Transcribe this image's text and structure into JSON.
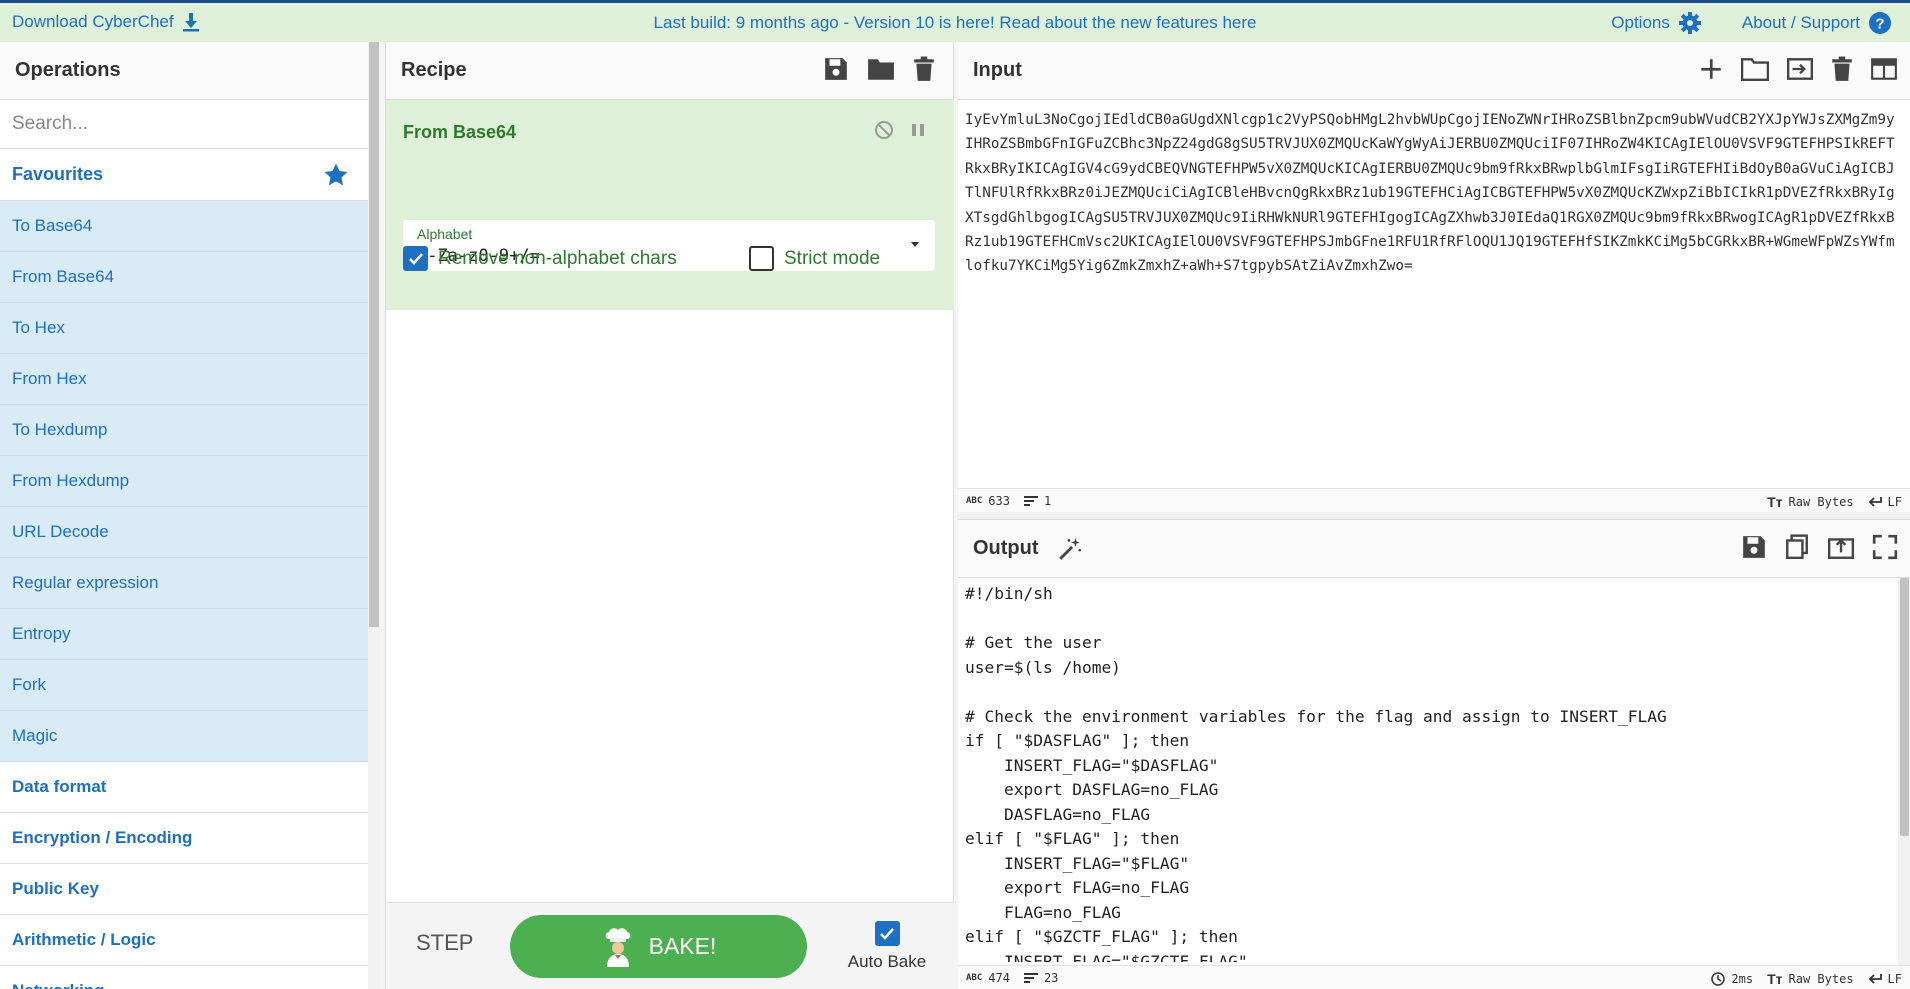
{
  "banner": {
    "download": "Download CyberChef",
    "message": "Last build: 9 months ago - Version 10 is here! Read about the new features here",
    "options": "Options",
    "about": "About / Support"
  },
  "operations": {
    "title": "Operations",
    "search_placeholder": "Search...",
    "favourites_label": "Favourites",
    "favourites": [
      "To Base64",
      "From Base64",
      "To Hex",
      "From Hex",
      "To Hexdump",
      "From Hexdump",
      "URL Decode",
      "Regular expression",
      "Entropy",
      "Fork",
      "Magic"
    ],
    "categories": [
      "Data format",
      "Encryption / Encoding",
      "Public Key",
      "Arithmetic / Logic",
      "Networking"
    ]
  },
  "recipe": {
    "title": "Recipe",
    "operation": {
      "name": "From Base64",
      "alphabet_label": "Alphabet",
      "alphabet_value": "A-Za-z0-9+/=",
      "remove_non_alphabet_label": "Remove non-alphabet chars",
      "remove_non_alphabet_checked": true,
      "strict_mode_label": "Strict mode",
      "strict_mode_checked": false
    },
    "step_label": "STEP",
    "bake_label": "BAKE!",
    "auto_bake_label": "Auto Bake",
    "auto_bake_checked": true
  },
  "input": {
    "title": "Input",
    "text": "IyEvYmluL3NoCgojIEdldCB0aGUgdXNlcgp1c2VyPSQobHMgL2hvbWUpCgojIENoZWNrIHRoZSBlbnZpcm9ubWVudCB2YXJpYWJsZXMgZm9yIHRoZSBmbGFnIGFuZCBhc3NpZ24gdG8gSU5TRVJUX0ZMQUcKaWYgWyAiJERBU0ZMQUciIF07IHRoZW4KICAgIElOU0VSVF9GTEFHPSIkREFTRkxBRyIKICAgIGV4cG9ydCBEQVNGTEFHPW5vX0ZMQUcKICAgIERBU0ZMQUc9bm9fRkxBRwplbGlmIFsgIiRGTEFHIiBdOyB0aGVuCiAgICBJTlNFUlRfRkxBRz0iJEZMQUciCiAgICBleHBvcnQgRkxBRz1ub19GTEFHCiAgICBGTEFHPW5vX0ZMQUcKZWxpZiBbICIkR1pDVEZfRkxBRyIgXTsgdGhlbgogICAgSU5TRVJUX0ZMQUc9IiRHWkNURl9GTEFHIgogICAgZXhwb3J0IEdaQ1RGX0ZMQUc9bm9fRkxBRwogICAgR1pDVEZfRkxBRz1ub19GTEFHCmVsc2UKICAgIElOU0VSVF9GTEFHPSJmbGFne1RFU1RfRFlOQU1JQ19GTEFHfSIKZmkKCiMg5bCGRkxBR+WGmeWFpWZsYWfmlofku7YKCiMg5Yig6ZmkZmxhZ+aWh+S7tgpybSAtZiAvZmxhZwo=",
    "chars_count": "633",
    "lines_count": "1",
    "encoding": "Raw Bytes",
    "eol": "LF"
  },
  "output": {
    "title": "Output",
    "lines": [
      "#!/bin/sh",
      "",
      "# Get the user",
      "user=$(ls /home)",
      "",
      "# Check the environment variables for the flag and assign to INSERT_FLAG",
      "if [ \"$DASFLAG\" ]; then",
      "    INSERT_FLAG=\"$DASFLAG\"",
      "    export DASFLAG=no_FLAG",
      "    DASFLAG=no_FLAG",
      "elif [ \"$FLAG\" ]; then",
      "    INSERT_FLAG=\"$FLAG\"",
      "    export FLAG=no_FLAG",
      "    FLAG=no_FLAG",
      "elif [ \"$GZCTF_FLAG\" ]; then",
      "    INSERT_FLAG=\"$GZCTF_FLAG\""
    ],
    "chars_count": "474",
    "lines_count": "23",
    "time": "2ms",
    "encoding": "Raw Bytes",
    "eol": "LF"
  },
  "colors": {
    "accent": "#1d6fc2",
    "banner_bg": "#dff0d8",
    "favourites_bg": "#d9ebf7",
    "operation_bg": "#dff0d8",
    "bake_button": "#4caf50"
  }
}
